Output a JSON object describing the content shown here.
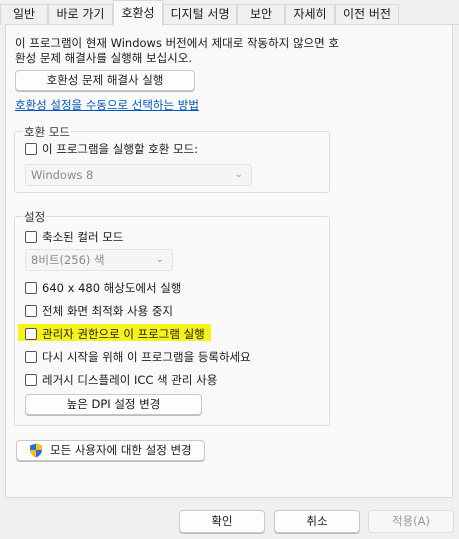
{
  "tabs": [
    "일반",
    "바로 가기",
    "호환성",
    "디지털 서명",
    "보안",
    "자세히",
    "이전 버전"
  ],
  "intro_text": "이 프로그램이 현재 Windows 버전에서 제대로 작동하지 않으면 호환성 문제 해결사를 실행해 보십시오.",
  "troubleshooter_button": "호환성 문제 해결사 실행",
  "manual_link": "호환성 설정을 수동으로 선택하는 방법",
  "compat_mode": {
    "title": "호환 모드",
    "checkbox_label": "이 프로그램을 실행할 호환 모드:",
    "dropdown_value": "Windows 8"
  },
  "settings": {
    "title": "설정",
    "reduced_color_label": "축소된 컬러 모드",
    "color_dropdown_value": "8비트(256) 색",
    "res_640_label": "640 x 480 해상도에서 실행",
    "fullscreen_opt_label": "전체 화면 최적화 사용 중지",
    "admin_label": "관리자 권한으로 이 프로그램 실행",
    "register_restart_label": "다시 시작을 위해 이 프로그램을 등록하세요",
    "legacy_icc_label": "레거시 디스플레이 ICC 색 관리 사용",
    "dpi_button": "높은 DPI 설정 변경"
  },
  "all_users_button": "모든 사용자에 대한 설정 변경",
  "footer": {
    "ok": "확인",
    "cancel": "취소",
    "apply": "적용(A)"
  },
  "colors": {
    "highlight": "#f6f21a",
    "link": "#0057b8",
    "shield_blue": "#2a6fd6",
    "shield_yellow": "#f2c21b"
  }
}
